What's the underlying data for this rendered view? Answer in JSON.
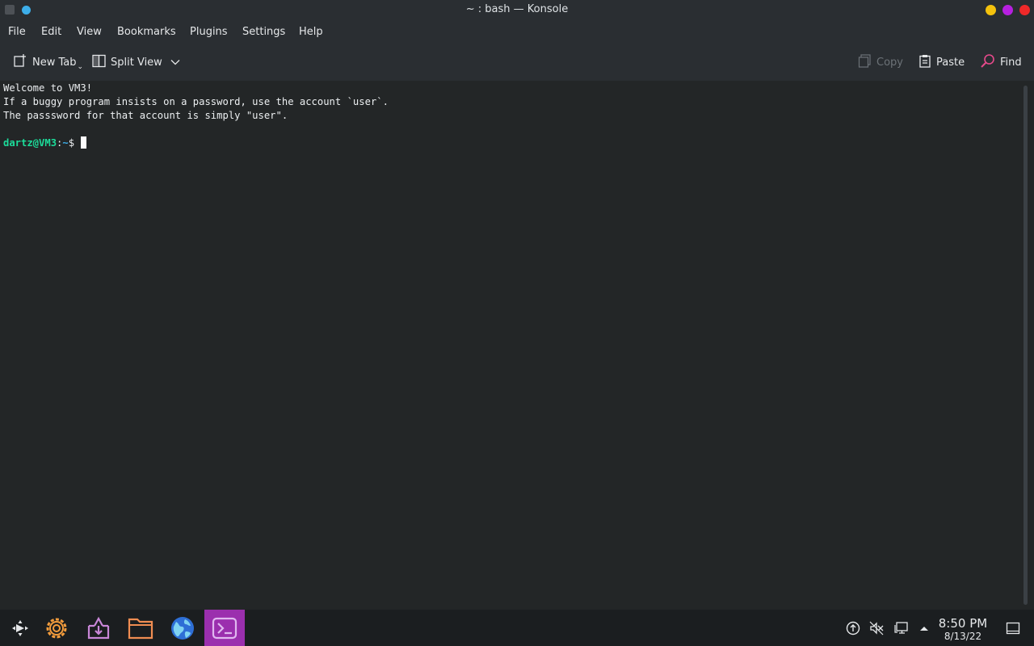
{
  "window": {
    "title": "~ : bash — Konsole"
  },
  "menu": [
    "File",
    "Edit",
    "View",
    "Bookmarks",
    "Plugins",
    "Settings",
    "Help"
  ],
  "toolbar": {
    "new_tab": "New Tab",
    "split_view": "Split View",
    "copy": "Copy",
    "paste": "Paste",
    "find": "Find"
  },
  "terminal": {
    "lines": [
      "Welcome to VM3!",
      "If a buggy program insists on a password, use the account `user`.",
      "The passsword for that account is simply \"user\"."
    ],
    "prompt_user": "dartz@VM3",
    "prompt_sep": ":",
    "prompt_path": "~",
    "prompt_symbol": "$"
  },
  "taskbar": {
    "apps": [
      "application-launcher-icon",
      "system-settings-icon",
      "discover-icon",
      "dolphin-folder-icon",
      "web-browser-icon",
      "konsole-icon"
    ],
    "clock_time": "8:50 PM",
    "clock_date": "8/13/22"
  },
  "colors": {
    "accent": "#3daee9",
    "prompt_user": "#1cdc9a",
    "minimize": "#f4c20d",
    "maximize": "#b620e0",
    "close": "#ef2929",
    "active_app": "#9b2fae"
  }
}
